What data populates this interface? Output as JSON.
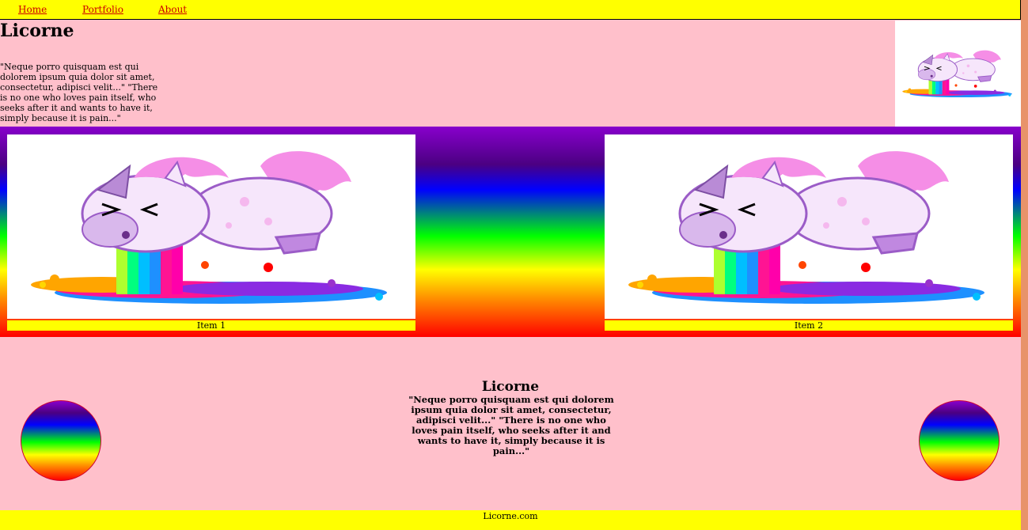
{
  "nav": {
    "items": [
      "Home",
      "Portfolio",
      "About"
    ]
  },
  "header": {
    "title": "Licorne",
    "text": "\"Neque porro quisquam est qui dolorem ipsum quia dolor sit amet, consectetur, adipisci velit...\" \"There is no one who loves pain itself, who seeks after it and wants to have it, simply because it is pain...\""
  },
  "gallery": {
    "items": [
      {
        "caption": "Item 1"
      },
      {
        "caption": "Item 2"
      }
    ]
  },
  "section": {
    "title": "Licorne",
    "text": "\"Neque porro quisquam est qui dolorem ipsum quia dolor sit amet, consectetur, adipisci velit...\" \"There is no one who loves pain itself, who seeks after it and wants to have it, simply because it is pain...\""
  },
  "footer": {
    "text": "Licorne.com"
  },
  "colors": {
    "nav_bg": "#ffff00",
    "page_bg": "#ffc0cb",
    "link": "#cc0000"
  },
  "icons": {
    "unicorn": "unicorn-rainbow-image"
  }
}
